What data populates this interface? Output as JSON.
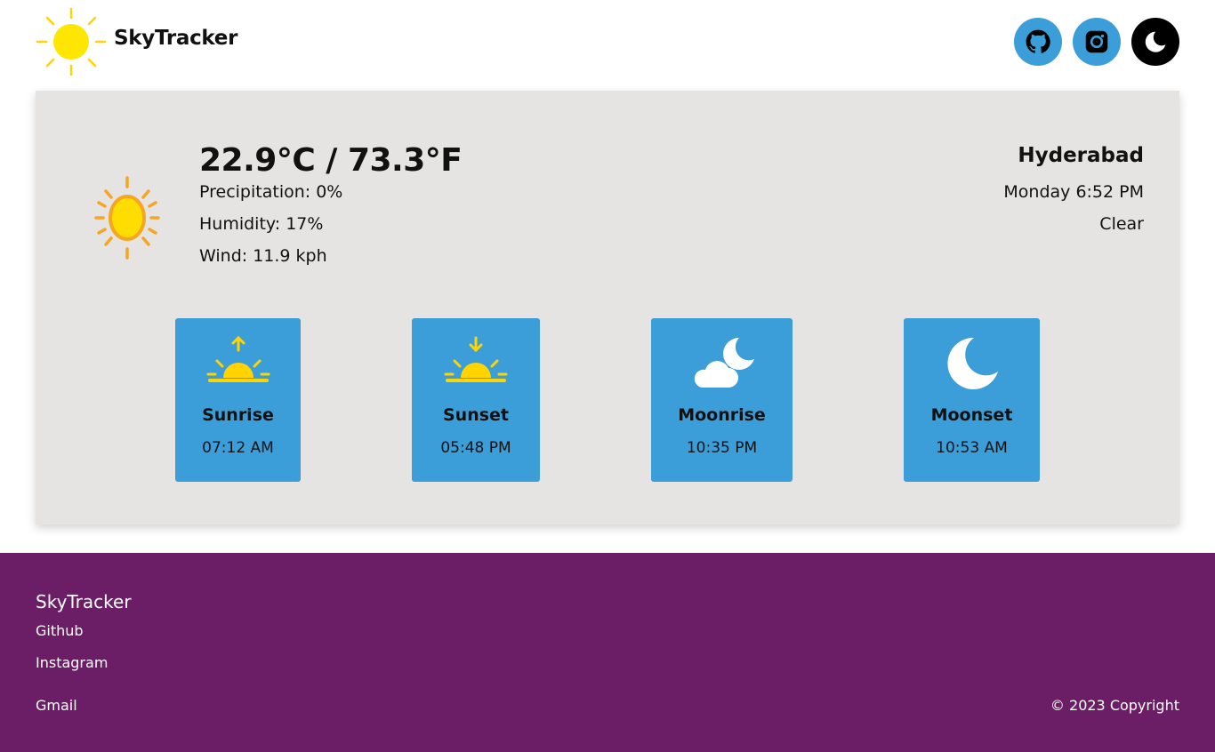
{
  "header": {
    "brand": "SkyTracker",
    "logo_icon": "sun-icon",
    "buttons": [
      {
        "name": "github-button",
        "icon": "github-icon"
      },
      {
        "name": "instagram-button",
        "icon": "instagram-icon"
      },
      {
        "name": "theme-toggle-button",
        "icon": "moon-icon"
      }
    ]
  },
  "weather": {
    "icon": "sun-icon",
    "temperature": "22.9°C / 73.3°F",
    "precipitation": "Precipitation: 0%",
    "humidity": "Humidity: 17%",
    "wind": "Wind: 11.9 kph",
    "city": "Hyderabad",
    "datetime": "Monday 6:52 PM",
    "condition": "Clear"
  },
  "astro": [
    {
      "label": "Sunrise",
      "time": "07:12 AM",
      "icon": "sunrise-icon"
    },
    {
      "label": "Sunset",
      "time": "05:48 PM",
      "icon": "sunset-icon"
    },
    {
      "label": "Moonrise",
      "time": "10:35 PM",
      "icon": "cloud-moon-icon"
    },
    {
      "label": "Moonset",
      "time": "10:53 AM",
      "icon": "moon-icon"
    }
  ],
  "footer": {
    "title": "SkyTracker",
    "links": [
      "Github",
      "Instagram",
      "Gmail"
    ],
    "copyright": "© 2023 Copyright"
  },
  "colors": {
    "accent_blue": "#3b9ed8",
    "footer_purple": "#6b1e66",
    "card_gray": "#e5e4e2",
    "sun_yellow": "#ffdd00",
    "sun_orange": "#f5a623"
  }
}
